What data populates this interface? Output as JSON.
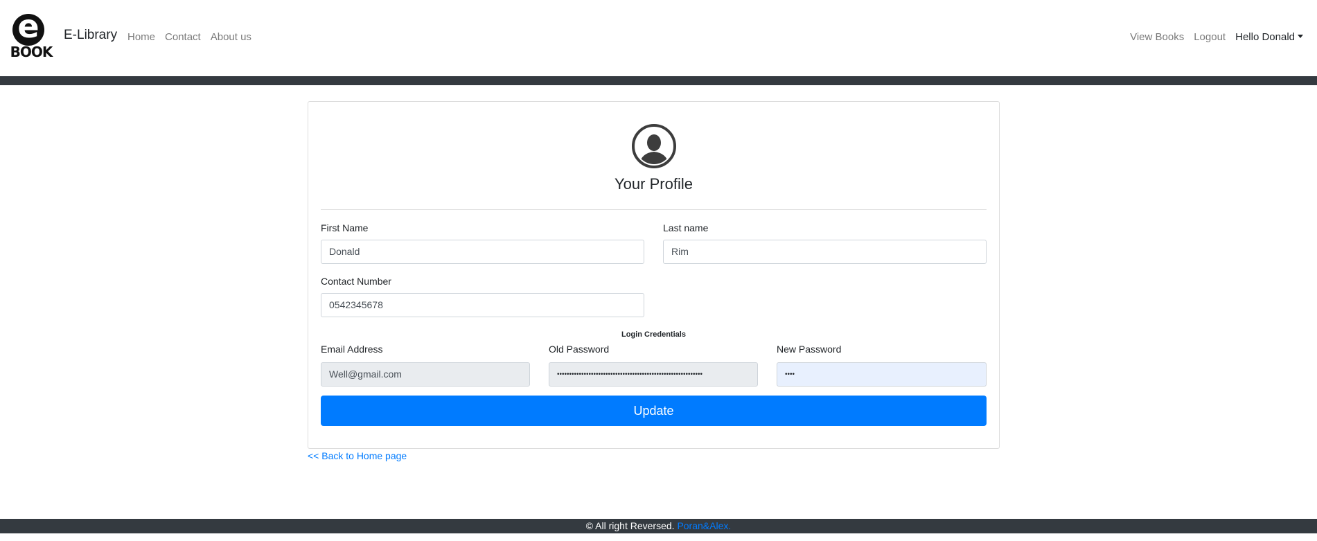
{
  "navbar": {
    "logo_letter": "e",
    "logo_word": "BOOK",
    "brand": "E-Library",
    "links_left": [
      "Home",
      "Contact",
      "About us"
    ],
    "links_right": [
      "View Books",
      "Logout"
    ],
    "user_menu": "Hello Donald"
  },
  "profile": {
    "title": "Your Profile",
    "first_name": {
      "label": "First Name",
      "value": "Donald"
    },
    "last_name": {
      "label": "Last name",
      "value": "Rim"
    },
    "contact": {
      "label": "Contact Number",
      "value": "0542345678"
    },
    "credentials_heading": "Login Credentials",
    "email": {
      "label": "Email Address",
      "value": "Well@gmail.com"
    },
    "old_password": {
      "label": "Old Password",
      "value": "••••••••••••••••••••••••••••••••••••••••••••••••••••••••••••"
    },
    "new_password": {
      "label": "New Password",
      "value": "••••"
    },
    "update_button": "Update"
  },
  "back_link": "<< Back to Home page",
  "footer": {
    "text": "© All right Reversed.",
    "link": "Poran&Alex."
  },
  "colors": {
    "primary": "#007bff",
    "dark_bar": "#343a40",
    "readonly_bg": "#e9ecef",
    "autofill_bg": "#e8f0fe"
  }
}
